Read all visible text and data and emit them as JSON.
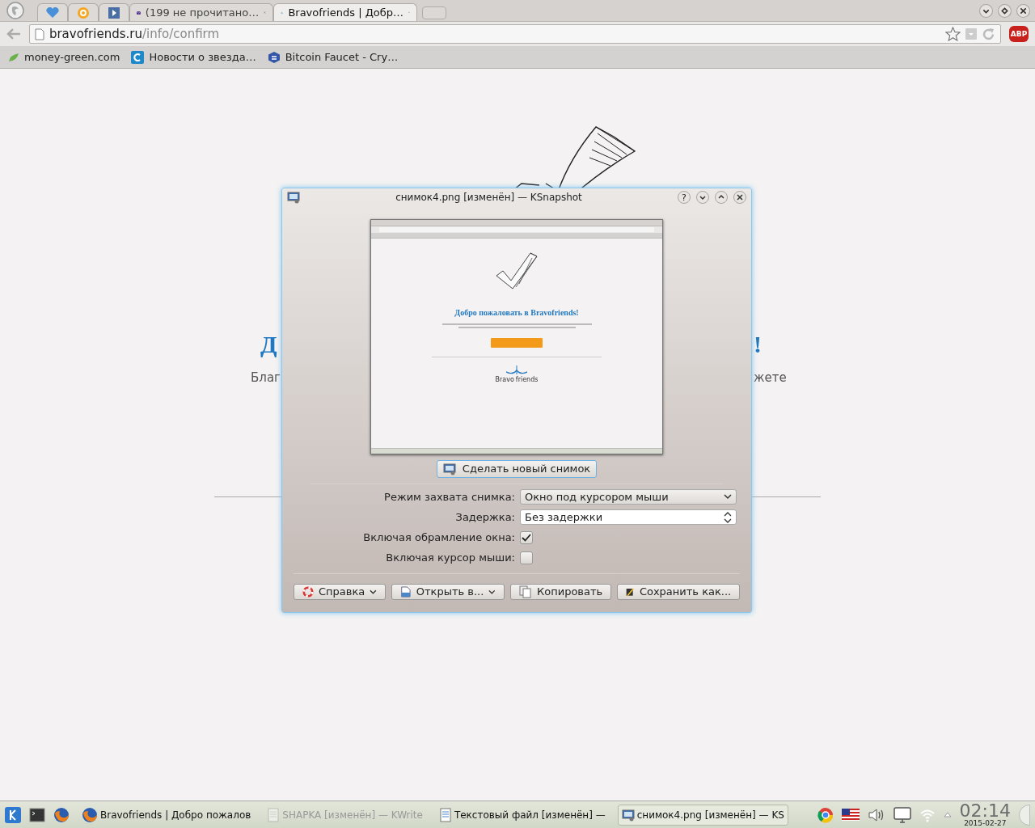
{
  "browser": {
    "tabs": [
      {
        "kind": "pinned",
        "selected": false
      },
      {
        "kind": "pinned",
        "selected": false
      },
      {
        "kind": "pinned",
        "selected": false
      },
      {
        "kind": "page",
        "label": "(199 не прочитано…",
        "selected": false
      },
      {
        "kind": "page",
        "label": "Bravofriends | Добр…",
        "selected": true
      }
    ],
    "address_bar": {
      "host": "bravofriends.ru",
      "path": "/info/confirm"
    },
    "adblock_label": "ABP",
    "bookmarks": [
      {
        "label": "money-green.com"
      },
      {
        "label": "Новости о звезда…"
      },
      {
        "label": "Bitcoin Faucet - Cry…"
      }
    ]
  },
  "page": {
    "heading_left": "Д",
    "heading_right": "!",
    "text_left": "Благ",
    "text_right": "жете"
  },
  "dialog": {
    "title": "снимок4.png [изменён] — KSnapshot",
    "help_label": "?",
    "preview": {
      "heading": "Добро пожаловать в Bravofriends!",
      "logo_left": "Bravo",
      "logo_right": "friends"
    },
    "new_snapshot_button": "Сделать новый снимок",
    "fields": [
      {
        "kind": "combo",
        "label": "Режим захвата снимка:",
        "value": "Окно под курсором мыши"
      },
      {
        "kind": "spin",
        "label": "Задержка:",
        "value": "Без задержки"
      },
      {
        "kind": "checkbox",
        "label": "Включая обрамление окна:",
        "checked": true
      },
      {
        "kind": "checkbox",
        "label": "Включая курсор мыши:",
        "checked": false
      }
    ],
    "buttons": [
      {
        "label": "Справка",
        "menu": true
      },
      {
        "label": "Открыть в...",
        "menu": true
      },
      {
        "label": "Копировать",
        "menu": false
      },
      {
        "label": "Сохранить как...",
        "menu": false
      }
    ]
  },
  "taskbar": {
    "tasks": [
      {
        "label": "Bravofriends | Добро пожалов",
        "dimmed": false,
        "selected": false
      },
      {
        "label": "SHAPKA [изменён] — KWrite",
        "dimmed": true,
        "selected": false
      },
      {
        "label": "Текстовый файл [изменён] —",
        "dimmed": false,
        "selected": false
      },
      {
        "label": "снимок4.png [изменён] — KS",
        "dimmed": false,
        "selected": true
      }
    ],
    "clock": "02:14",
    "date": "2015-02-27"
  }
}
